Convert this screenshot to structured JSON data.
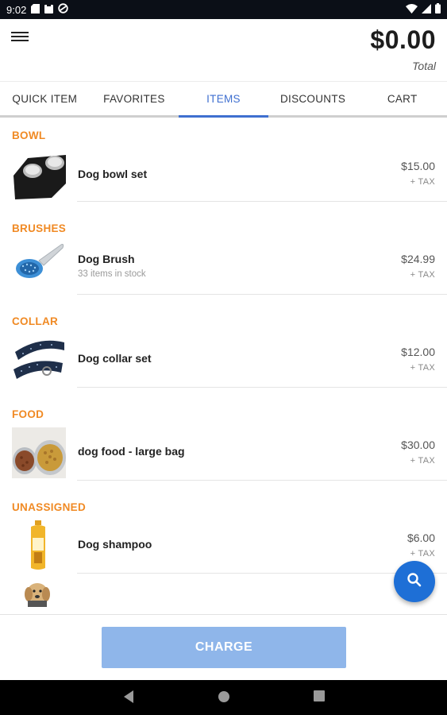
{
  "status_bar": {
    "time": "9:02",
    "icons": [
      "sd-card-icon",
      "clipboard-icon",
      "data-saver-icon",
      "wifi-icon",
      "cell-signal-icon",
      "battery-icon"
    ]
  },
  "header": {
    "total_amount": "$0.00",
    "total_label": "Total"
  },
  "tabs": [
    {
      "label": "QUICK ITEM",
      "active": false
    },
    {
      "label": "FAVORITES",
      "active": false
    },
    {
      "label": "ITEMS",
      "active": true
    },
    {
      "label": "DISCOUNTS",
      "active": false
    },
    {
      "label": "CART",
      "active": false
    }
  ],
  "categories": [
    {
      "name": "BOWL",
      "items": [
        {
          "name": "Dog bowl set",
          "sub": "",
          "price": "$15.00",
          "tax": "+ TAX",
          "icon": "dog-bowl-image"
        }
      ]
    },
    {
      "name": "BRUSHES",
      "items": [
        {
          "name": "Dog Brush",
          "sub": "33 items in stock",
          "price": "$24.99",
          "tax": "+ TAX",
          "icon": "dog-brush-image"
        }
      ]
    },
    {
      "name": "COLLAR",
      "items": [
        {
          "name": "Dog collar set",
          "sub": "",
          "price": "$12.00",
          "tax": "+ TAX",
          "icon": "dog-collar-image"
        }
      ]
    },
    {
      "name": "FOOD",
      "items": [
        {
          "name": "dog food - large bag",
          "sub": "",
          "price": "$30.00",
          "tax": "+ TAX",
          "icon": "dog-food-image"
        }
      ]
    },
    {
      "name": "UNASSIGNED",
      "items": [
        {
          "name": "Dog shampoo",
          "sub": "",
          "price": "$6.00",
          "tax": "+ TAX",
          "icon": "dog-shampoo-image"
        }
      ]
    }
  ],
  "footer": {
    "charge_label": "CHARGE"
  },
  "colors": {
    "accent": "#3f6fd0",
    "category": "#f08a24",
    "fab": "#1e6fd6",
    "charge_button": "#8fb6ea"
  }
}
